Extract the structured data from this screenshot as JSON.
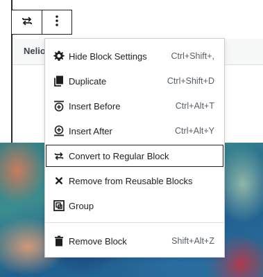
{
  "block": {
    "header_text": "Nelio",
    "toolbar": {
      "convert_icon": "convert-arrows-icon",
      "options_icon": "more-vertical-icon"
    }
  },
  "menu": {
    "items": [
      {
        "label": "Hide Block Settings",
        "shortcut": "Ctrl+Shift+,",
        "icon": "gear-icon"
      },
      {
        "label": "Duplicate",
        "shortcut": "Ctrl+Shift+D",
        "icon": "duplicate-icon"
      },
      {
        "label": "Insert Before",
        "shortcut": "Ctrl+Alt+T",
        "icon": "insert-before-icon"
      },
      {
        "label": "Insert After",
        "shortcut": "Ctrl+Alt+Y",
        "icon": "insert-after-icon"
      },
      {
        "label": "Convert to Regular Block",
        "shortcut": "",
        "icon": "convert-arrows-icon"
      },
      {
        "label": "Remove from Reusable Blocks",
        "shortcut": "",
        "icon": "close-icon"
      },
      {
        "label": "Group",
        "shortcut": "",
        "icon": "group-icon"
      },
      {
        "label": "Remove Block",
        "shortcut": "Shift+Alt+Z",
        "icon": "trash-icon"
      }
    ]
  }
}
